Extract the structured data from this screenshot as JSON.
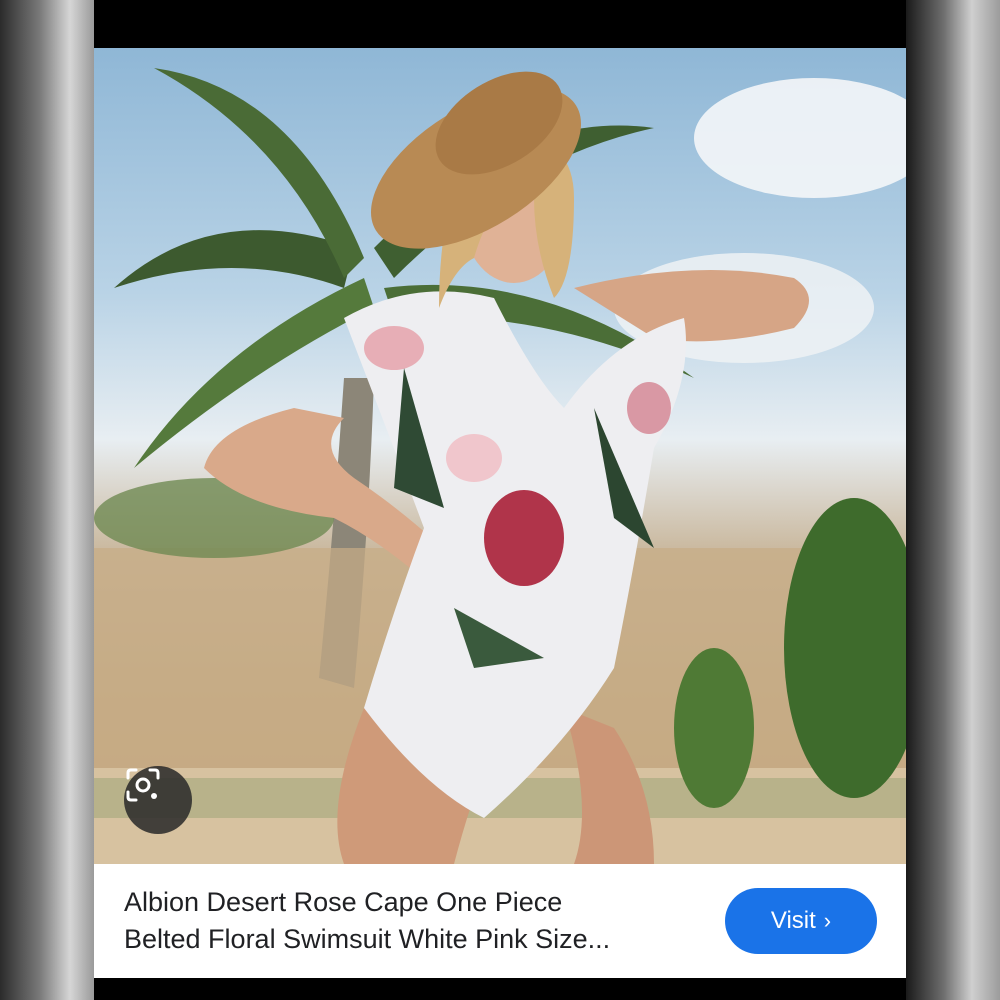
{
  "result_card": {
    "title_line_1": "Albion Desert Rose Cape One Piece",
    "title_line_2": "Belted Floral Swimsuit White Pink Size...",
    "visit_label": "Visit",
    "visit_chevron": "›",
    "visit_color": "#1a73e8"
  },
  "icons": {
    "lens": "visual-search-lens-icon"
  }
}
